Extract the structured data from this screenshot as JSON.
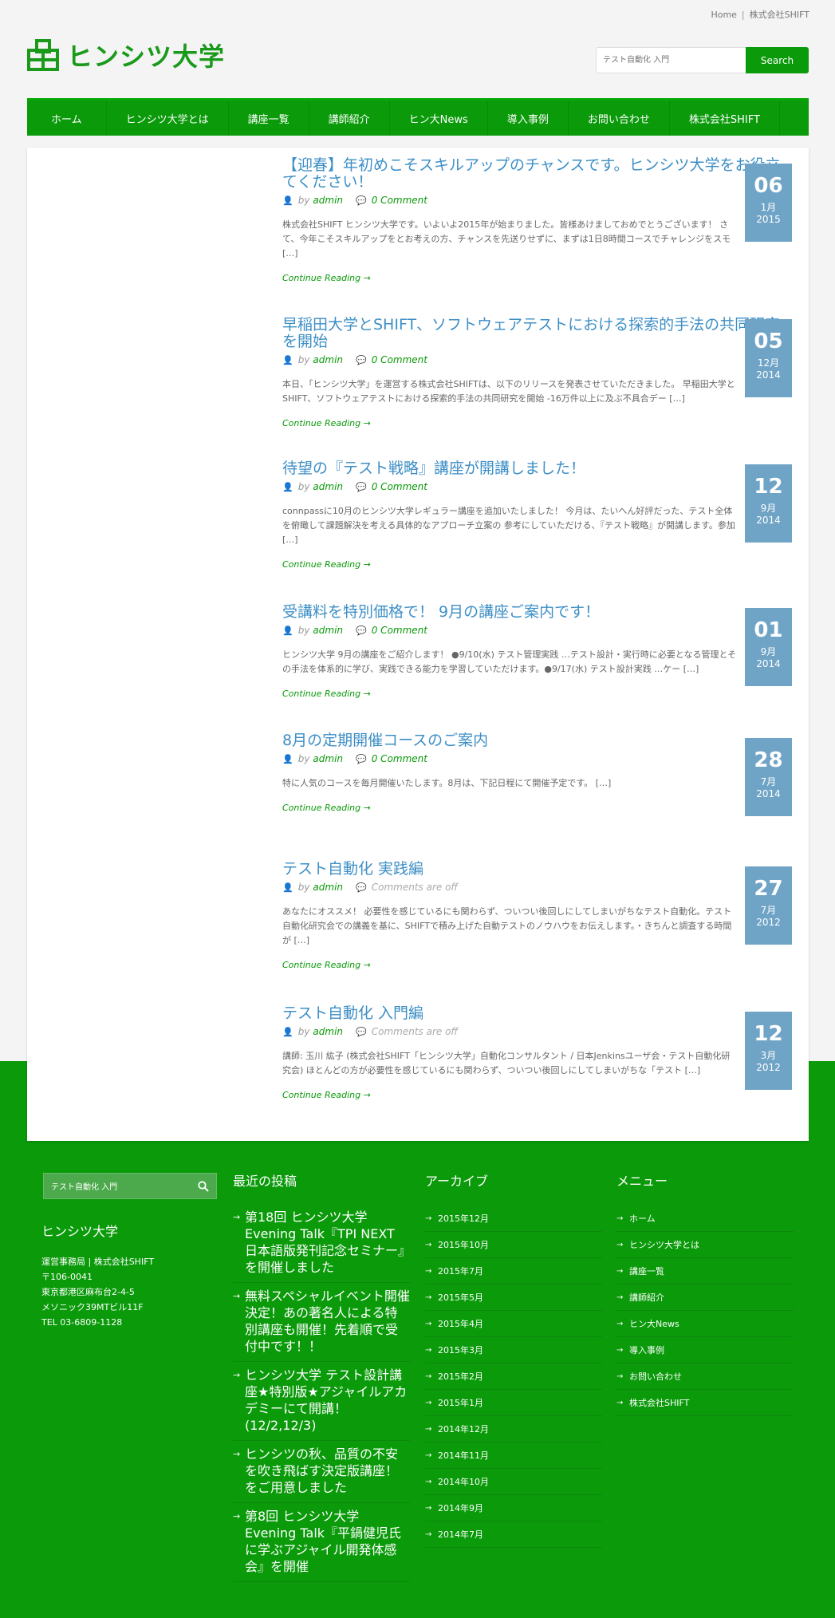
{
  "topbar": {
    "home": "Home",
    "company": "株式会社SHIFT"
  },
  "logo": {
    "name": "ヒンシツ大学",
    "icon": "logo-building-icon"
  },
  "search": {
    "placeholder": "テスト自動化 入門",
    "button": "Search"
  },
  "nav": [
    "ホーム",
    "ヒンシツ大学とは",
    "講座一覧",
    "講師紹介",
    "ヒン大News",
    "導入事例",
    "お問い合わせ",
    "株式会社SHIFT"
  ],
  "posts": [
    {
      "title": "【迎春】年初めこそスキルアップのチャンスです。ヒンシツ大学をお役立てください！",
      "by": "by",
      "author": "admin",
      "comments": "0 Comment",
      "excerpt": "株式会社SHIFT ヒンシツ大学です。いよいよ2015年が始まりました。皆様あけましておめでとうございます！ さて、今年こそスキルアップをとお考えの方、チャンスを先送りせずに、まずは1日8時間コースでチャレンジをスモ […]",
      "more": "Continue Reading →",
      "day": "06",
      "month": "1月",
      "year": "2015"
    },
    {
      "title": "早稲田大学とSHIFT、ソフトウェアテストにおける探索的手法の共同研究を開始",
      "by": "by",
      "author": "admin",
      "comments": "0 Comment",
      "excerpt": "本日、「ヒンシツ大学」を運営する株式会社SHIFTは、以下のリリースを発表させていただきました。 早稲田大学とSHIFT、ソフトウェアテストにおける探索的手法の共同研究を開始 -16万件以上に及ぶ不具合デー […]",
      "more": "Continue Reading →",
      "day": "05",
      "month": "12月",
      "year": "2014"
    },
    {
      "title": "待望の『テスト戦略』講座が開講しました！",
      "by": "by",
      "author": "admin",
      "comments": "0 Comment",
      "excerpt": "connpassに10月のヒンシツ大学レギュラー講座を追加いたしました！ 今月は、たいへん好評だった、テスト全体を俯瞰して課題解決を考える具体的なアプローチ立案の 参考にしていただける、『テスト戦略』が開講します。参加 […]",
      "more": "Continue Reading →",
      "day": "12",
      "month": "9月",
      "year": "2014"
    },
    {
      "title": "受講料を特別価格で！ 9月の講座ご案内です！",
      "by": "by",
      "author": "admin",
      "comments": "0 Comment",
      "excerpt": "ヒンシツ大学 9月の講座をご紹介します！ ●9/10(水) テスト管理実践 …テスト設計・実行時に必要となる管理とその手法を体系的に学び、実践できる能力を学習していただけます。●9/17(水) テスト設計実践 …ケー […]",
      "more": "Continue Reading →",
      "day": "01",
      "month": "9月",
      "year": "2014"
    },
    {
      "title": "8月の定期開催コースのご案内",
      "by": "by",
      "author": "admin",
      "comments": "0 Comment",
      "excerpt": "特に人気のコースを毎月開催いたします。8月は、下記日程にて開催予定です。 […]",
      "more": "Continue Reading →",
      "day": "28",
      "month": "7月",
      "year": "2014"
    },
    {
      "title": "テスト自動化 実践編",
      "by": "by",
      "author": "admin",
      "comments": "Comments are off",
      "excerpt": "あなたにオススメ！ 必要性を感じているにも関わらず、ついつい後回しにしてしまいがちなテスト自動化。テスト自動化研究会での講義を基に、SHIFTで積み上げた自動テストのノウハウをお伝えします。・きちんと調査する時間が […]",
      "more": "Continue Reading →",
      "day": "27",
      "month": "7月",
      "year": "2012"
    },
    {
      "title": "テスト自動化 入門編",
      "by": "by",
      "author": "admin",
      "comments": "Comments are off",
      "excerpt": "講師: 玉川 紘子 (株式会社SHIFT「ヒンシツ大学」自動化コンサルタント / 日本Jenkinsユーザ会・テスト自動化研究会) ほとんどの方が必要性を感じているにも関わらず、ついつい後回しにしてしまいがちな「テスト […]",
      "more": "Continue Reading →",
      "day": "12",
      "month": "3月",
      "year": "2012"
    }
  ],
  "footer": {
    "search_placeholder": "テスト自動化 入門",
    "about": {
      "title": "ヒンシツ大学",
      "lines": [
        "運営事務局 | 株式会社SHIFT",
        "〒106-0041",
        "東京都港区麻布台2-4-5",
        "メソニック39MTビル11F",
        "TEL 03-6809-1128"
      ]
    },
    "recent": {
      "title": "最近の投稿",
      "items": [
        "第18回 ヒンシツ大学 Evening Talk『TPI NEXT 日本語版発刊記念セミナー』を開催しました",
        "無料スペシャルイベント開催決定！あの著名人による特別講座も開催！先着順で受付中です！！",
        "ヒンシツ大学 テスト設計講座★特別版★アジャイルアカデミーにて開講！(12/2,12/3)",
        "ヒンシツの秋、品質の不安を吹き飛ばす決定版講座！をご用意しました",
        "第8回 ヒンシツ大学 Evening Talk『平鍋健児氏に学ぶアジャイル開発体感会』を開催"
      ]
    },
    "archive": {
      "title": "アーカイブ",
      "items": [
        "2015年12月",
        "2015年10月",
        "2015年7月",
        "2015年5月",
        "2015年4月",
        "2015年3月",
        "2015年2月",
        "2015年1月",
        "2014年12月",
        "2014年11月",
        "2014年10月",
        "2014年9月",
        "2014年7月"
      ]
    },
    "menu": {
      "title": "メニュー",
      "items": [
        "ホーム",
        "ヒンシツ大学とは",
        "講座一覧",
        "講師紹介",
        "ヒン大News",
        "導入事例",
        "お問い合わせ",
        "株式会社SHIFT"
      ]
    }
  },
  "colors": {
    "brand_green": "#0a9a0a",
    "date_blue": "#6fa4c6",
    "title_blue": "#3d8fc6"
  }
}
